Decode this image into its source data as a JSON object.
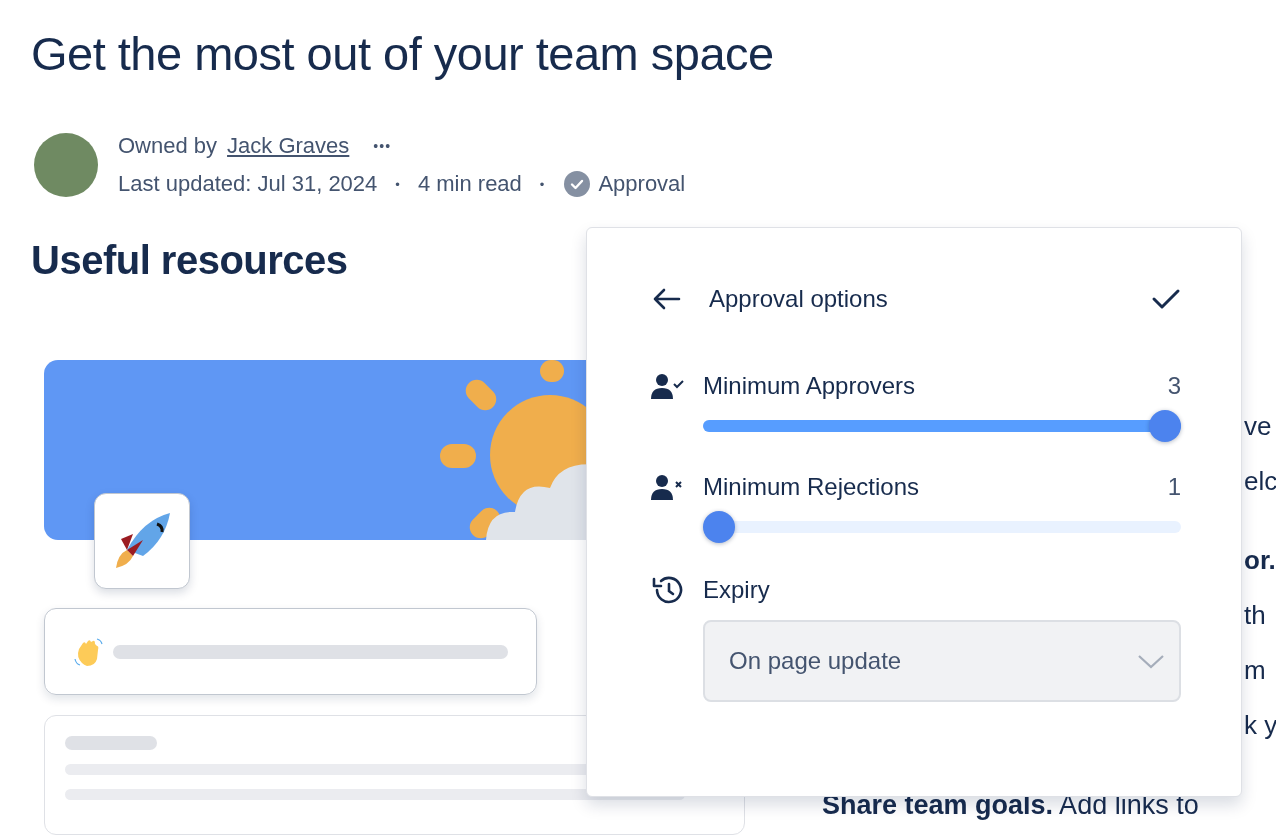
{
  "page": {
    "title": "Get the most out of your team space"
  },
  "byline": {
    "owned_by_label": "Owned by",
    "owner": "Jack Graves",
    "more": "•••",
    "last_updated": "Last updated: Jul 31, 2024",
    "separator_1": "•",
    "read_time": "4 min read",
    "separator_2": "•",
    "status": "Approval"
  },
  "section_heading": "Useful resources",
  "body_paragraphs": [
    [
      {
        "text": "ve",
        "bold": false
      },
      {
        "text": "elc",
        "bold": false
      }
    ],
    [
      {
        "text": "or.",
        "bold": true
      },
      {
        "text": "th",
        "bold": false
      },
      {
        "text": "m",
        "bold": false
      },
      {
        "text": "k y",
        "bold": false
      }
    ]
  ],
  "body_last_line": "**Share team goals.** Add links to",
  "popover": {
    "title": "Approval options",
    "sliders": [
      {
        "kind": "approve",
        "label": "Minimum Approvers",
        "reading": "3",
        "level": 1.0
      },
      {
        "kind": "reject",
        "label": "Minimum Rejections",
        "reading": "1",
        "level": 0.0
      }
    ],
    "expiry": {
      "label": "Expiry",
      "value": "On page update"
    }
  }
}
